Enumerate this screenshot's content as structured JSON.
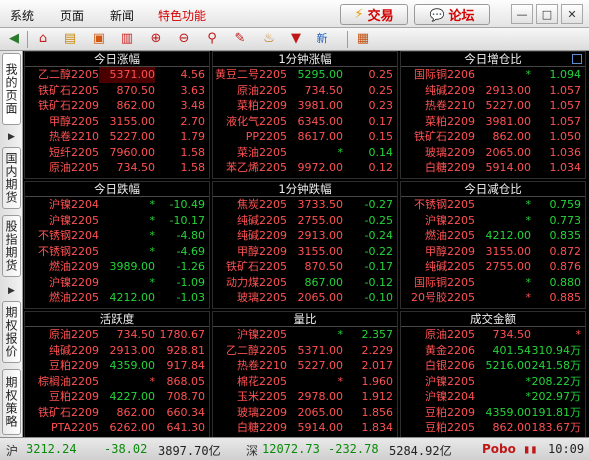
{
  "menu": {
    "items": [
      "系统",
      "页面",
      "新闻",
      "特色功能"
    ],
    "trade_label": "交易",
    "forum_label": "论坛"
  },
  "side_tabs": [
    "我的页面",
    "国内期货",
    "股指期货",
    "期权报价",
    "期权策略"
  ],
  "panels": [
    {
      "title": "今日涨幅",
      "name_color": "up",
      "rows": [
        {
          "name": "乙二醇2205",
          "name_color": "up",
          "price": "5371.00",
          "price_color": "red",
          "val": "4.56",
          "val_color": "red",
          "hl": true
        },
        {
          "name": "铁矿石2205",
          "name_color": "up",
          "price": "870.50",
          "price_color": "red",
          "val": "3.63",
          "val_color": "red"
        },
        {
          "name": "铁矿石2209",
          "name_color": "up",
          "price": "862.00",
          "price_color": "red",
          "val": "3.48",
          "val_color": "red"
        },
        {
          "name": "甲醇2205",
          "name_color": "up",
          "price": "3155.00",
          "price_color": "red",
          "val": "2.70",
          "val_color": "red"
        },
        {
          "name": "热卷2210",
          "name_color": "up",
          "price": "5227.00",
          "price_color": "red",
          "val": "1.79",
          "val_color": "red"
        },
        {
          "name": "短纤2205",
          "name_color": "up",
          "price": "7960.00",
          "price_color": "red",
          "val": "1.58",
          "val_color": "red"
        },
        {
          "name": "原油2205",
          "name_color": "up",
          "price": "734.50",
          "price_color": "red",
          "val": "1.58",
          "val_color": "red"
        }
      ]
    },
    {
      "title": "1分钟涨幅",
      "rows": [
        {
          "name": "黄豆二号2205",
          "name_color": "up",
          "price": "5295.00",
          "price_color": "green",
          "val": "0.25",
          "val_color": "red"
        },
        {
          "name": "原油2205",
          "name_color": "up",
          "price": "734.50",
          "price_color": "red",
          "val": "0.25",
          "val_color": "red"
        },
        {
          "name": "菜粕2209",
          "name_color": "up",
          "price": "3981.00",
          "price_color": "red",
          "val": "0.23",
          "val_color": "red"
        },
        {
          "name": "液化气2205",
          "name_color": "up",
          "price": "6345.00",
          "price_color": "red",
          "val": "0.17",
          "val_color": "red"
        },
        {
          "name": "PP2205",
          "name_color": "up",
          "price": "8617.00",
          "price_color": "red",
          "val": "0.15",
          "val_color": "red"
        },
        {
          "name": "菜油2205",
          "name_color": "up",
          "price": "*",
          "price_color": "green",
          "val": "0.14",
          "val_color": "green"
        },
        {
          "name": "苯乙烯2205",
          "name_color": "up",
          "price": "9972.00",
          "price_color": "red",
          "val": "0.12",
          "val_color": "red"
        }
      ]
    },
    {
      "title": "今日增仓比",
      "rows": [
        {
          "name": "国际铜2206",
          "name_color": "up",
          "price": "*",
          "price_color": "green",
          "val": "1.094",
          "val_color": "green"
        },
        {
          "name": "纯碱2209",
          "name_color": "up",
          "price": "2913.00",
          "price_color": "red",
          "val": "1.057",
          "val_color": "red"
        },
        {
          "name": "热卷2210",
          "name_color": "up",
          "price": "5227.00",
          "price_color": "red",
          "val": "1.057",
          "val_color": "red"
        },
        {
          "name": "菜粕2209",
          "name_color": "up",
          "price": "3981.00",
          "price_color": "red",
          "val": "1.057",
          "val_color": "red"
        },
        {
          "name": "铁矿石2209",
          "name_color": "up",
          "price": "862.00",
          "price_color": "red",
          "val": "1.050",
          "val_color": "red"
        },
        {
          "name": "玻璃2209",
          "name_color": "up",
          "price": "2065.00",
          "price_color": "red",
          "val": "1.036",
          "val_color": "red"
        },
        {
          "name": "白糖2209",
          "name_color": "up",
          "price": "5914.00",
          "price_color": "red",
          "val": "1.034",
          "val_color": "red"
        }
      ]
    },
    {
      "title": "今日跌幅",
      "rows": [
        {
          "name": "沪镍2204",
          "name_color": "up",
          "price": "*",
          "price_color": "green",
          "val": "-10.49",
          "val_color": "green"
        },
        {
          "name": "沪镍2205",
          "name_color": "up",
          "price": "*",
          "price_color": "green",
          "val": "-10.17",
          "val_color": "green"
        },
        {
          "name": "不锈钢2204",
          "name_color": "up",
          "price": "*",
          "price_color": "green",
          "val": "-4.80",
          "val_color": "green"
        },
        {
          "name": "不锈钢2205",
          "name_color": "up",
          "price": "*",
          "price_color": "green",
          "val": "-4.69",
          "val_color": "green"
        },
        {
          "name": "燃油2209",
          "name_color": "up",
          "price": "3989.00",
          "price_color": "green",
          "val": "-1.26",
          "val_color": "green"
        },
        {
          "name": "沪镍2209",
          "name_color": "up",
          "price": "*",
          "price_color": "green",
          "val": "-1.09",
          "val_color": "green"
        },
        {
          "name": "燃油2205",
          "name_color": "up",
          "price": "4212.00",
          "price_color": "green",
          "val": "-1.03",
          "val_color": "green"
        }
      ]
    },
    {
      "title": "1分钟跌幅",
      "rows": [
        {
          "name": "焦炭2205",
          "name_color": "up",
          "price": "3733.50",
          "price_color": "red",
          "val": "-0.27",
          "val_color": "green"
        },
        {
          "name": "纯碱2205",
          "name_color": "up",
          "price": "2755.00",
          "price_color": "red",
          "val": "-0.25",
          "val_color": "green"
        },
        {
          "name": "纯碱2209",
          "name_color": "up",
          "price": "2913.00",
          "price_color": "red",
          "val": "-0.24",
          "val_color": "green"
        },
        {
          "name": "甲醇2209",
          "name_color": "up",
          "price": "3155.00",
          "price_color": "red",
          "val": "-0.22",
          "val_color": "green"
        },
        {
          "name": "铁矿石2205",
          "name_color": "up",
          "price": "870.50",
          "price_color": "red",
          "val": "-0.17",
          "val_color": "green"
        },
        {
          "name": "动力煤2205",
          "name_color": "up",
          "price": "867.00",
          "price_color": "green",
          "val": "-0.12",
          "val_color": "green"
        },
        {
          "name": "玻璃2205",
          "name_color": "up",
          "price": "2065.00",
          "price_color": "red",
          "val": "-0.10",
          "val_color": "green"
        }
      ]
    },
    {
      "title": "今日减仓比",
      "rows": [
        {
          "name": "不锈钢2205",
          "name_color": "up",
          "price": "*",
          "price_color": "green",
          "val": "0.759",
          "val_color": "green"
        },
        {
          "name": "沪镍2205",
          "name_color": "up",
          "price": "*",
          "price_color": "green",
          "val": "0.773",
          "val_color": "green"
        },
        {
          "name": "燃油2205",
          "name_color": "up",
          "price": "4212.00",
          "price_color": "green",
          "val": "0.835",
          "val_color": "green"
        },
        {
          "name": "甲醇2209",
          "name_color": "up",
          "price": "3155.00",
          "price_color": "red",
          "val": "0.872",
          "val_color": "red"
        },
        {
          "name": "纯碱2205",
          "name_color": "up",
          "price": "2755.00",
          "price_color": "red",
          "val": "0.876",
          "val_color": "red"
        },
        {
          "name": "国际铜2205",
          "name_color": "up",
          "price": "*",
          "price_color": "green",
          "val": "0.880",
          "val_color": "green"
        },
        {
          "name": "20号胶2205",
          "name_color": "up",
          "price": "*",
          "price_color": "red",
          "val": "0.885",
          "val_color": "red"
        }
      ]
    },
    {
      "title": "活跃度",
      "rows": [
        {
          "name": "原油2205",
          "name_color": "up",
          "price": "734.50",
          "price_color": "red",
          "val": "1780.67",
          "val_color": "red"
        },
        {
          "name": "纯碱2209",
          "name_color": "up",
          "price": "2913.00",
          "price_color": "red",
          "val": "928.81",
          "val_color": "red"
        },
        {
          "name": "豆粕2209",
          "name_color": "up",
          "price": "4359.00",
          "price_color": "green",
          "val": "917.84",
          "val_color": "red"
        },
        {
          "name": "棕榈油2205",
          "name_color": "up",
          "price": "*",
          "price_color": "red",
          "val": "868.05",
          "val_color": "red"
        },
        {
          "name": "豆粕2209",
          "name_color": "up",
          "price": "4227.00",
          "price_color": "green",
          "val": "708.70",
          "val_color": "red"
        },
        {
          "name": "铁矿石2209",
          "name_color": "up",
          "price": "862.00",
          "price_color": "red",
          "val": "660.34",
          "val_color": "red"
        },
        {
          "name": "PTA2205",
          "name_color": "up",
          "price": "6262.00",
          "price_color": "red",
          "val": "641.30",
          "val_color": "red"
        }
      ]
    },
    {
      "title": "量比",
      "rows": [
        {
          "name": "沪镍2205",
          "name_color": "up",
          "price": "*",
          "price_color": "green",
          "val": "2.357",
          "val_color": "green"
        },
        {
          "name": "乙二醇2205",
          "name_color": "up",
          "price": "5371.00",
          "price_color": "red",
          "val": "2.229",
          "val_color": "red"
        },
        {
          "name": "热卷2210",
          "name_color": "up",
          "price": "5227.00",
          "price_color": "red",
          "val": "2.017",
          "val_color": "red"
        },
        {
          "name": "棉花2205",
          "name_color": "up",
          "price": "*",
          "price_color": "red",
          "val": "1.960",
          "val_color": "red"
        },
        {
          "name": "玉米2205",
          "name_color": "up",
          "price": "2978.00",
          "price_color": "red",
          "val": "1.912",
          "val_color": "red"
        },
        {
          "name": "玻璃2209",
          "name_color": "up",
          "price": "2065.00",
          "price_color": "red",
          "val": "1.856",
          "val_color": "red"
        },
        {
          "name": "白糖2209",
          "name_color": "up",
          "price": "5914.00",
          "price_color": "red",
          "val": "1.834",
          "val_color": "red"
        }
      ]
    },
    {
      "title": "成交金额",
      "rows": [
        {
          "name": "原油2205",
          "name_color": "up",
          "price": "734.50",
          "price_color": "red",
          "val": "*",
          "val_color": "red"
        },
        {
          "name": "黄金2206",
          "name_color": "up",
          "price": "401.54",
          "price_color": "green",
          "val": "310.94万",
          "val_color": "green"
        },
        {
          "name": "白银2206",
          "name_color": "up",
          "price": "5216.00",
          "price_color": "green",
          "val": "241.58万",
          "val_color": "green"
        },
        {
          "name": "沪镍2205",
          "name_color": "up",
          "price": "*",
          "price_color": "green",
          "val": "208.22万",
          "val_color": "green"
        },
        {
          "name": "沪镍2204",
          "name_color": "up",
          "price": "*",
          "price_color": "green",
          "val": "202.97万",
          "val_color": "green"
        },
        {
          "name": "豆粕2209",
          "name_color": "up",
          "price": "4359.00",
          "price_color": "green",
          "val": "191.81万",
          "val_color": "green"
        },
        {
          "name": "豆粕2205",
          "name_color": "up",
          "price": "862.00",
          "price_color": "red",
          "val": "183.67万",
          "val_color": "red"
        }
      ]
    }
  ],
  "status": {
    "sh_label": "沪",
    "sh_index": "3212.24",
    "sh_change": "-38.02",
    "sh_amount": "3897.70亿",
    "sz_label": "深",
    "sz_index": "12072.73",
    "sz_change": "-232.78",
    "sz_amount": "5284.92亿",
    "brand": "Pobo",
    "time": "10:09"
  },
  "colors": {
    "up": "#ff5252",
    "down": "#25d43a",
    "yellow": "#f2e128"
  }
}
